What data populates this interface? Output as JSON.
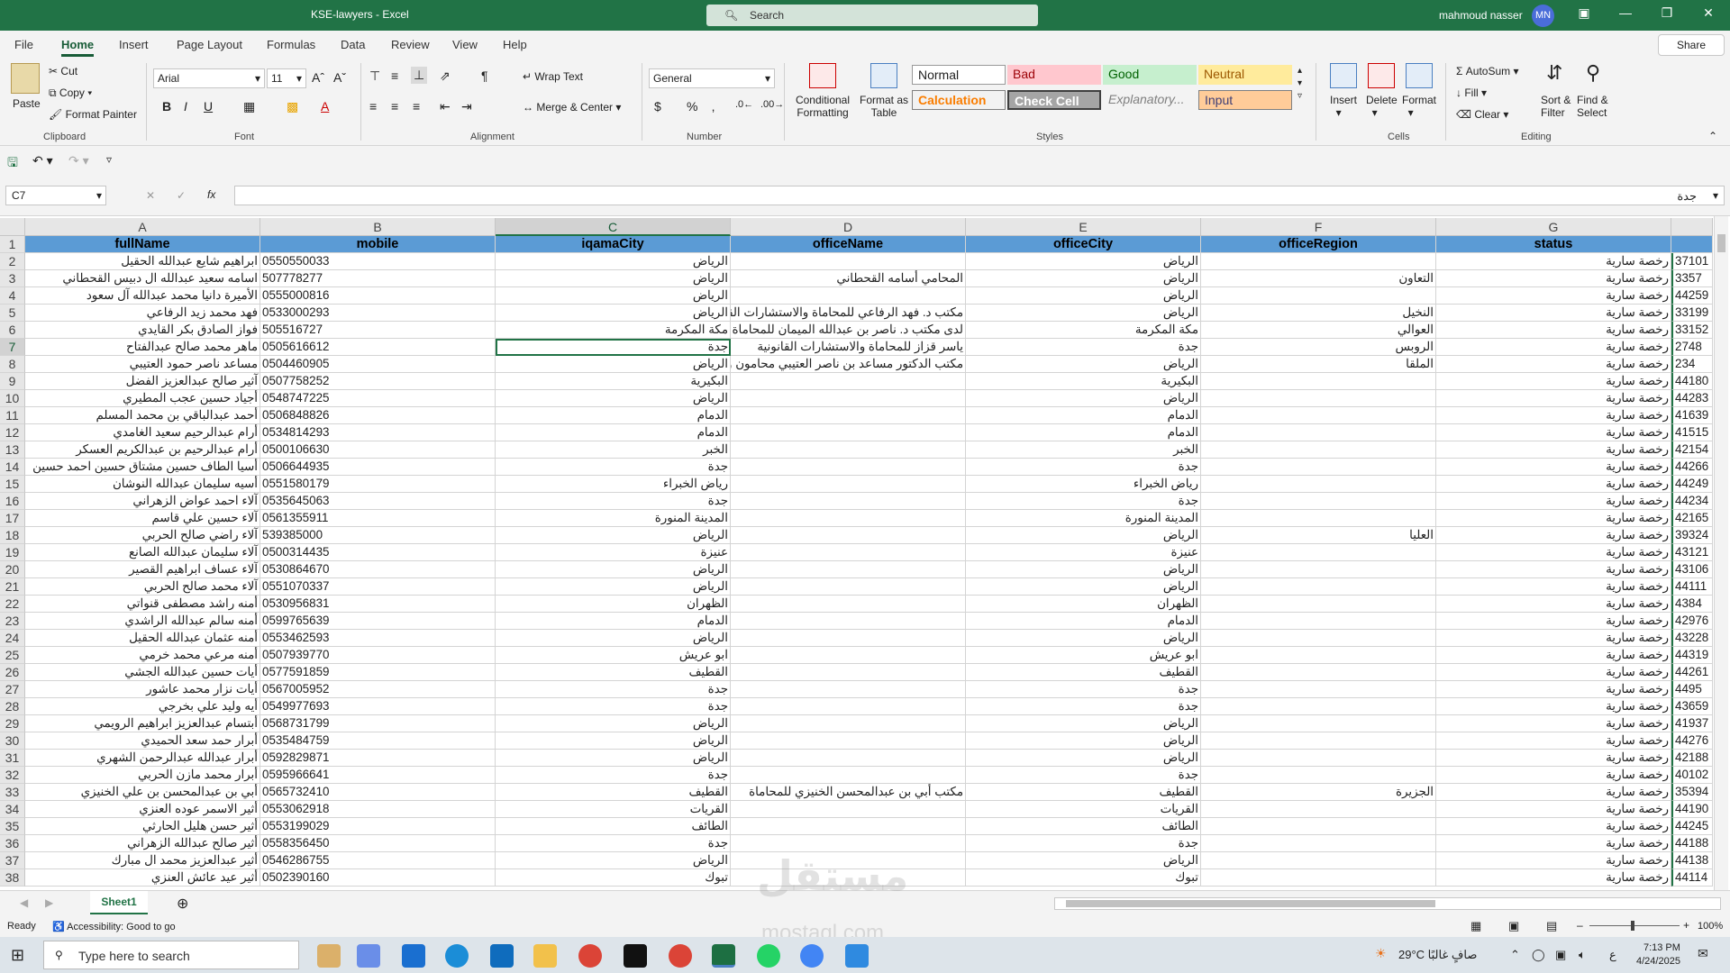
{
  "window": {
    "title": "KSE-lawyers  -  Excel",
    "search_placeholder": "Search",
    "user_name": "mahmoud nasser",
    "user_initials": "MN"
  },
  "menu": {
    "tabs": [
      "File",
      "Home",
      "Insert",
      "Page Layout",
      "Formulas",
      "Data",
      "Review",
      "View",
      "Help"
    ],
    "active_tab": "Home",
    "share_label": "Share"
  },
  "ribbon": {
    "clipboard": {
      "paste": "Paste",
      "cut": "Cut",
      "copy": "Copy",
      "format_painter": "Format Painter",
      "label": "Clipboard"
    },
    "font": {
      "name": "Arial",
      "size": "11",
      "label": "Font"
    },
    "alignment": {
      "wrap_text": "Wrap Text",
      "merge_center": "Merge & Center",
      "label": "Alignment"
    },
    "number": {
      "format": "General",
      "label": "Number"
    },
    "styles": {
      "conditional": "Conditional",
      "conditional2": "Formatting",
      "format_as": "Format as",
      "format_as2": "Table",
      "cells": [
        "Normal",
        "Bad",
        "Good",
        "Neutral",
        "Calculation",
        "Check Cell",
        "Explanatory...",
        "Input"
      ],
      "label": "Styles"
    },
    "cells": {
      "insert": "Insert",
      "delete": "Delete",
      "format": "Format",
      "label": "Cells"
    },
    "editing": {
      "autosum": "AutoSum",
      "fill": "Fill",
      "clear": "Clear",
      "sort": "Sort &",
      "sort2": "Filter",
      "find": "Find &",
      "find2": "Select",
      "label": "Editing"
    }
  },
  "formula_bar": {
    "name_box": "C7",
    "content": "جدة"
  },
  "columns": [
    {
      "letter": "A",
      "header": "fullName"
    },
    {
      "letter": "B",
      "header": "mobile"
    },
    {
      "letter": "C",
      "header": "iqamaCity"
    },
    {
      "letter": "D",
      "header": "officeName"
    },
    {
      "letter": "E",
      "header": "officeCity"
    },
    {
      "letter": "F",
      "header": "officeRegion"
    },
    {
      "letter": "G",
      "header": "status"
    }
  ],
  "rows": [
    {
      "n": 2,
      "a": "ابراهيم شايع عبدالله الحقيل",
      "b": "0550550033",
      "c": "الرياض",
      "d": "",
      "e": "الرياض",
      "f": "",
      "g": "رخصة سارية",
      "h": "37101"
    },
    {
      "n": 3,
      "a": "اسامه سعيد عبدالله ال دبيس القحطاني",
      "b": "507778277",
      "c": "الرياض",
      "d": "المحامي أسامه القحطاني",
      "e": "الرياض",
      "f": "التعاون",
      "g": "رخصة سارية",
      "h": "3357"
    },
    {
      "n": 4,
      "a": "الأميرة دانيا محمد عبدالله آل سعود",
      "b": "0555000816",
      "c": "الرياض",
      "d": "",
      "e": "الرياض",
      "f": "",
      "g": "رخصة سارية",
      "h": "44259"
    },
    {
      "n": 5,
      "a": "فهد محمد زيد الرفاعي",
      "b": "0533000293",
      "c": "الرياض",
      "d": "مكتب د. فهد الرفاعي للمحاماة والاستشارات القانونيه و",
      "e": "الرياض",
      "f": "النخيل",
      "g": "رخصة سارية",
      "h": "33199"
    },
    {
      "n": 6,
      "a": "فواز الصادق بكر القايدي",
      "b": "505516727",
      "c": "مكة المكرمة",
      "d": "لدى مكتب د. ناصر بن عبدالله الميمان للمحاماة",
      "e": "مكة المكرمة",
      "f": "العوالي",
      "g": "رخصة سارية",
      "h": "33152"
    },
    {
      "n": 7,
      "a": "ماهر محمد صالح عبدالفتاح",
      "b": "0505616612",
      "c": "جدة",
      "d": "ياسر قزاز للمحاماة والاستشارات القانونية",
      "e": "جدة",
      "f": "الروبس",
      "g": "رخصة سارية",
      "h": "2748"
    },
    {
      "n": 8,
      "a": "مساعد ناصر حمود  العتيبي",
      "b": "0504460905",
      "c": "الرياض",
      "d": "مكتب الدكتور مساعد بن ناصر العتيبي محامون ومستشا",
      "e": "الرياض",
      "f": "الملقا",
      "g": "رخصة سارية",
      "h": "234"
    },
    {
      "n": 9,
      "a": "آثير صالح  عبدالعزيز الفضل",
      "b": "0507758252",
      "c": "البكيرية",
      "d": "",
      "e": "البكيرية",
      "f": "",
      "g": "رخصة سارية",
      "h": "44180"
    },
    {
      "n": 10,
      "a": "أجياد حسين عجب المطيري",
      "b": "0548747225",
      "c": "الرياض",
      "d": "",
      "e": "الرياض",
      "f": "",
      "g": "رخصة سارية",
      "h": "44283"
    },
    {
      "n": 11,
      "a": "أحمد عبدالباقي بن محمد المسلم",
      "b": "0506848826",
      "c": "الدمام",
      "d": "",
      "e": "الدمام",
      "f": "",
      "g": "رخصة سارية",
      "h": "41639"
    },
    {
      "n": 12,
      "a": "أرام عبدالرحيم  سعيد الغامدي",
      "b": "0534814293",
      "c": "الدمام",
      "d": "",
      "e": "الدمام",
      "f": "",
      "g": "رخصة سارية",
      "h": "41515"
    },
    {
      "n": 13,
      "a": "أرام عبدالرحيم بن عبدالكريم العسكر",
      "b": "0500106630",
      "c": "الخبر",
      "d": "",
      "e": "الخبر",
      "f": "",
      "g": "رخصة سارية",
      "h": "42154"
    },
    {
      "n": 14,
      "a": "أسيا الطاف حسين  مشتاق حسين احمد حسين",
      "b": "0506644935",
      "c": "جدة",
      "d": "",
      "e": "جدة",
      "f": "",
      "g": "رخصة سارية",
      "h": "44266"
    },
    {
      "n": 15,
      "a": "أسيه سليمان عبدالله النوشان",
      "b": "0551580179",
      "c": "رياض الخبراء",
      "d": "",
      "e": "رياض الخبراء",
      "f": "",
      "g": "رخصة سارية",
      "h": "44249"
    },
    {
      "n": 16,
      "a": "آلاء احمد عواض الزهراني",
      "b": "0535645063",
      "c": "جدة",
      "d": "",
      "e": "جدة",
      "f": "",
      "g": "رخصة سارية",
      "h": "44234"
    },
    {
      "n": 17,
      "a": "آلاء حسين علي قاسم",
      "b": "0561355911",
      "c": "المدينة المنورة",
      "d": "",
      "e": "المدينة المنورة",
      "f": "",
      "g": "رخصة سارية",
      "h": "42165"
    },
    {
      "n": 18,
      "a": "آلاء راضي صالح الحربي",
      "b": "539385000",
      "c": "الرياض",
      "d": "",
      "e": "الرياض",
      "f": "العليا",
      "g": "رخصة سارية",
      "h": "39324"
    },
    {
      "n": 19,
      "a": "آلاء سليمان عبدالله الصانع",
      "b": "0500314435",
      "c": "عنيزة",
      "d": "",
      "e": "عنيزة",
      "f": "",
      "g": "رخصة سارية",
      "h": "43121"
    },
    {
      "n": 20,
      "a": "آلاء عساف ابراهيم القصير",
      "b": "0530864670",
      "c": "الرياض",
      "d": "",
      "e": "الرياض",
      "f": "",
      "g": "رخصة سارية",
      "h": "43106"
    },
    {
      "n": 21,
      "a": "آلاء محمد صالح الحربي",
      "b": "0551070337",
      "c": "الرياض",
      "d": "",
      "e": "الرياض",
      "f": "",
      "g": "رخصة سارية",
      "h": "44111"
    },
    {
      "n": 22,
      "a": "أمنه راشد مصطفى قنواتي",
      "b": "0530956831",
      "c": "الظهران",
      "d": "",
      "e": "الظهران",
      "f": "",
      "g": "رخصة سارية",
      "h": "4384"
    },
    {
      "n": 23,
      "a": "أمنه سالم عبدالله الراشدي",
      "b": "0599765639",
      "c": "الدمام",
      "d": "",
      "e": "الدمام",
      "f": "",
      "g": "رخصة سارية",
      "h": "42976"
    },
    {
      "n": 24,
      "a": "أمنه عثمان عبدالله الحقيل",
      "b": "0553462593",
      "c": "الرياض",
      "d": "",
      "e": "الرياض",
      "f": "",
      "g": "رخصة سارية",
      "h": "43228"
    },
    {
      "n": 25,
      "a": "أمنه مرعي محمد خرمي",
      "b": "0507939770",
      "c": "ابو عريش",
      "d": "",
      "e": "ابو عريش",
      "f": "",
      "g": "رخصة سارية",
      "h": "44319"
    },
    {
      "n": 26,
      "a": "أيات حسين عبدالله الجشي",
      "b": "0577591859",
      "c": "القطيف",
      "d": "",
      "e": "القطيف",
      "f": "",
      "g": "رخصة سارية",
      "h": "44261"
    },
    {
      "n": 27,
      "a": "أيات نزار محمد عاشور",
      "b": "0567005952",
      "c": "جدة",
      "d": "",
      "e": "جدة",
      "f": "",
      "g": "رخصة سارية",
      "h": "4495"
    },
    {
      "n": 28,
      "a": "أيه وليد علي بخرجي",
      "b": "0549977693",
      "c": "جدة",
      "d": "",
      "e": "جدة",
      "f": "",
      "g": "رخصة سارية",
      "h": "43659"
    },
    {
      "n": 29,
      "a": "أبتسام عبدالعزيز ابراهيم الرويمي",
      "b": "0568731799",
      "c": "الرياض",
      "d": "",
      "e": "الرياض",
      "f": "",
      "g": "رخصة سارية",
      "h": "41937"
    },
    {
      "n": 30,
      "a": "أبرار حمد سعد الحميدي",
      "b": "0535484759",
      "c": "الرياض",
      "d": "",
      "e": "الرياض",
      "f": "",
      "g": "رخصة سارية",
      "h": "44276"
    },
    {
      "n": 31,
      "a": "أبرار عبدالله عبدالرحمن الشهري",
      "b": "0592829871",
      "c": "الرياض",
      "d": "",
      "e": "الرياض",
      "f": "",
      "g": "رخصة سارية",
      "h": "42188"
    },
    {
      "n": 32,
      "a": "أبرار محمد مازن الحربي",
      "b": "0595966641",
      "c": "جدة",
      "d": "",
      "e": "جدة",
      "f": "",
      "g": "رخصة سارية",
      "h": "40102"
    },
    {
      "n": 33,
      "a": "أبي بن عبدالمحسن بن علي الخنيزي",
      "b": "0565732410",
      "c": "القطيف",
      "d": "مكتب أبي بن عبدالمحسن الخنيزي للمحاماة",
      "e": "القطيف",
      "f": "الجزيرة",
      "g": "رخصة سارية",
      "h": "35394"
    },
    {
      "n": 34,
      "a": "أثير الاسمر عوده العنزي",
      "b": "0553062918",
      "c": "القريات",
      "d": "",
      "e": "القريات",
      "f": "",
      "g": "رخصة سارية",
      "h": "44190"
    },
    {
      "n": 35,
      "a": "أثير حسن هليل الحارثي",
      "b": "0553199029",
      "c": "الطائف",
      "d": "",
      "e": "الطائف",
      "f": "",
      "g": "رخصة سارية",
      "h": "44245"
    },
    {
      "n": 36,
      "a": "أثير صالح عبدالله الزهراني",
      "b": "0558356450",
      "c": "جدة",
      "d": "",
      "e": "جدة",
      "f": "",
      "g": "رخصة سارية",
      "h": "44188"
    },
    {
      "n": 37,
      "a": "أثير عبدالعزيز محمد ال مبارك",
      "b": "0546286755",
      "c": "الرياض",
      "d": "",
      "e": "الرياض",
      "f": "",
      "g": "رخصة سارية",
      "h": "44138"
    },
    {
      "n": 38,
      "a": "أثير عيد عائش العنزي",
      "b": "0502390160",
      "c": "تبوك",
      "d": "",
      "e": "تبوك",
      "f": "",
      "g": "رخصة سارية",
      "h": "44114"
    }
  ],
  "sheet_tabs": [
    "Sheet1"
  ],
  "status": {
    "ready": "Ready",
    "accessibility": "Accessibility: Good to go",
    "zoom": "100%"
  },
  "taskbar": {
    "search_placeholder": "Type here to search",
    "weather": "29°C  صافٍ غالبًا",
    "time": "7:13 PM",
    "date": "4/24/2025",
    "lang": "ع"
  },
  "watermark": {
    "text": "مستقل",
    "domain": "mostaql.com"
  }
}
